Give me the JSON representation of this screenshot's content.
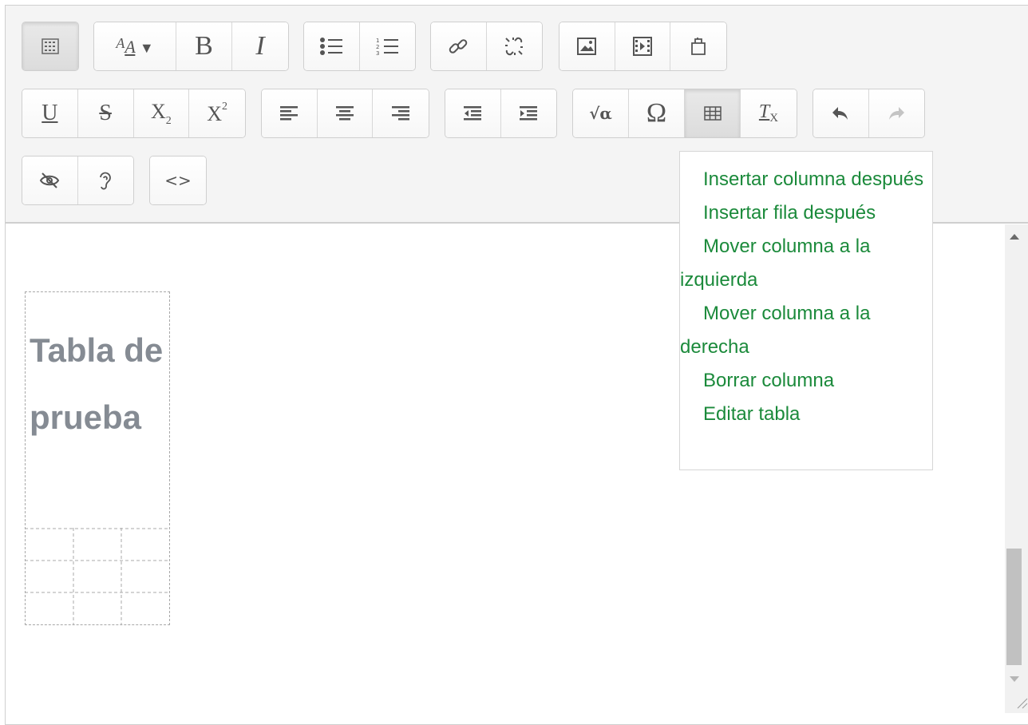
{
  "toolbar": {
    "row1": [
      {
        "group": "collapse",
        "buttons": [
          {
            "icon": "toolbar-toggle-icon",
            "pressed": true
          }
        ]
      },
      {
        "group": "style",
        "buttons": [
          {
            "icon": "font-style-icon",
            "label": "A"
          },
          {
            "icon": "bold-icon",
            "label": "B"
          },
          {
            "icon": "italic-icon",
            "label": "I"
          }
        ]
      },
      {
        "group": "lists",
        "buttons": [
          {
            "icon": "bullet-list-icon"
          },
          {
            "icon": "numbered-list-icon"
          }
        ]
      },
      {
        "group": "links",
        "buttons": [
          {
            "icon": "link-icon"
          },
          {
            "icon": "unlink-icon"
          }
        ]
      },
      {
        "group": "files",
        "buttons": [
          {
            "icon": "image-icon"
          },
          {
            "icon": "media-icon"
          },
          {
            "icon": "manage-files-icon"
          }
        ]
      }
    ],
    "row2": [
      {
        "group": "format",
        "buttons": [
          {
            "icon": "underline-icon",
            "label": "U"
          },
          {
            "icon": "strikethrough-icon",
            "label": "S"
          },
          {
            "icon": "subscript-icon",
            "label": "X",
            "sub": "2"
          },
          {
            "icon": "superscript-icon",
            "label": "X",
            "sup": "2"
          }
        ]
      },
      {
        "group": "align",
        "buttons": [
          {
            "icon": "align-left-icon"
          },
          {
            "icon": "align-center-icon"
          },
          {
            "icon": "align-right-icon"
          }
        ]
      },
      {
        "group": "indent",
        "buttons": [
          {
            "icon": "outdent-icon"
          },
          {
            "icon": "indent-icon"
          }
        ]
      },
      {
        "group": "insert",
        "buttons": [
          {
            "icon": "equation-icon",
            "label": "√α"
          },
          {
            "icon": "special-char-icon",
            "label": "Ω"
          },
          {
            "icon": "table-icon",
            "pressed": true
          },
          {
            "icon": "clear-format-icon",
            "label": "T",
            "sub": "X"
          }
        ]
      },
      {
        "group": "history",
        "buttons": [
          {
            "icon": "undo-icon"
          },
          {
            "icon": "redo-icon",
            "disabled": true
          }
        ]
      }
    ],
    "row3": [
      {
        "group": "accessibility",
        "buttons": [
          {
            "icon": "accessibility-checker-icon"
          },
          {
            "icon": "screenreader-helper-icon"
          }
        ]
      },
      {
        "group": "html",
        "buttons": [
          {
            "icon": "html-source-icon",
            "label": "<>"
          }
        ]
      }
    ]
  },
  "table_menu": {
    "items": [
      {
        "label": "Insertar columna después"
      },
      {
        "label": "Insertar fila después"
      },
      {
        "label": "Mover columna a la izquierda"
      },
      {
        "label": "Mover columna a la derecha"
      },
      {
        "label": "Borrar columna"
      },
      {
        "label": "Editar tabla"
      }
    ]
  },
  "content": {
    "table_caption": "Tabla de prueba",
    "table_rows": 3,
    "table_cols": 3
  },
  "colors": {
    "menu_text": "#1b8a3b",
    "caption_text": "#858b93",
    "toolbar_bg": "#f4f4f4"
  }
}
